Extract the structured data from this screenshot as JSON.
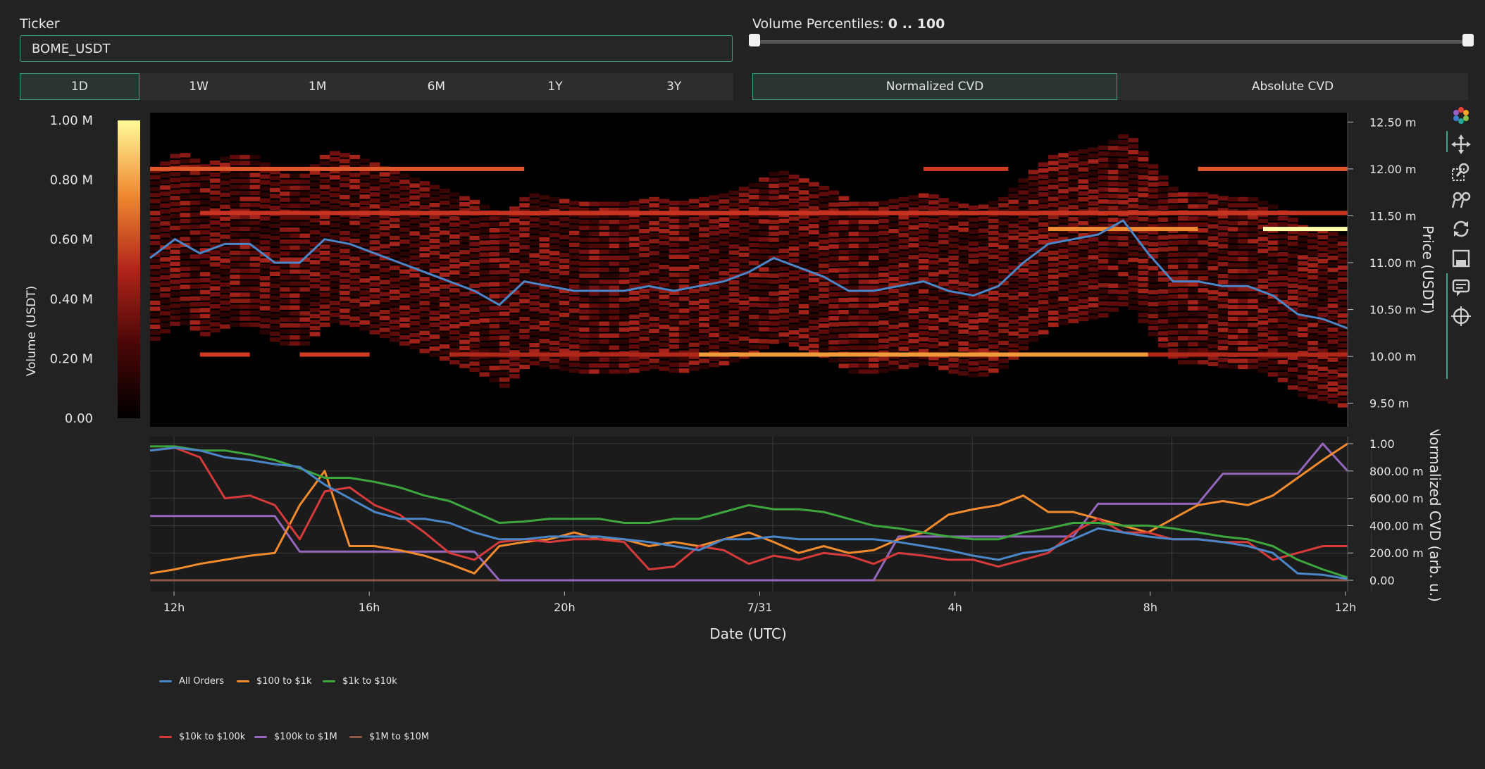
{
  "ticker": {
    "label": "Ticker",
    "value": "BOME_USDT"
  },
  "volume_percentiles": {
    "label": "Volume Percentiles:",
    "range": "0 .. 100",
    "low": 0,
    "high": 100
  },
  "timeframes": [
    "1D",
    "1W",
    "1M",
    "6M",
    "1Y",
    "3Y"
  ],
  "active_timeframe": "1D",
  "cvd_modes": [
    "Normalized CVD",
    "Absolute CVD"
  ],
  "active_cvd_mode": "Normalized CVD",
  "modebar": [
    "logo-icon",
    "pan-icon",
    "zoom-icon",
    "autoscale-icon",
    "reset-icon",
    "save-icon",
    "hover-icon",
    "spike-icon"
  ],
  "colors": {
    "accent": "#3fa08a",
    "All Orders": "#4a86c8",
    "$100 to $1k": "#f28a2e",
    "$1k to $10k": "#3ea63e",
    "$10k to $100k": "#d63a3a",
    "$100k to $1M": "#9467bd",
    "$1M to $10M": "#8c564b"
  },
  "chart_data": [
    {
      "type": "heatmap",
      "ylabel": "Price (USDT)",
      "colorbar_label": "Volume (USDT)",
      "colorbar_ticks": [
        "0.00",
        "0.20 M",
        "0.40 M",
        "0.60 M",
        "0.80 M",
        "1.00 M"
      ],
      "y_ticks": [
        "9.50 m",
        "10.00 m",
        "10.50 m",
        "11.00 m",
        "11.50 m",
        "12.00 m",
        "12.50 m"
      ],
      "ylim": [
        9.25,
        12.6
      ],
      "price_series": {
        "name": "Price",
        "x_hours": [
          0,
          0.5,
          1,
          1.5,
          2,
          2.5,
          3,
          3.5,
          4,
          4.5,
          5,
          5.5,
          6,
          6.5,
          7,
          7.5,
          8,
          8.5,
          9,
          9.5,
          10,
          10.5,
          11,
          11.5,
          12,
          12.5,
          13,
          13.5,
          14,
          14.5,
          15,
          15.5,
          16,
          16.5,
          17,
          17.5,
          18,
          18.5,
          19,
          19.5,
          20,
          20.5,
          21,
          21.5,
          22,
          22.5,
          23,
          23.5,
          24
        ],
        "values": [
          11.05,
          11.25,
          11.1,
          11.2,
          11.2,
          11.0,
          11.0,
          11.25,
          11.2,
          11.1,
          11.0,
          10.9,
          10.8,
          10.7,
          10.55,
          10.8,
          10.75,
          10.7,
          10.7,
          10.7,
          10.75,
          10.7,
          10.75,
          10.8,
          10.9,
          11.05,
          10.95,
          10.85,
          10.7,
          10.7,
          10.75,
          10.8,
          10.7,
          10.65,
          10.75,
          11.0,
          11.2,
          11.25,
          11.3,
          11.45,
          11.1,
          10.8,
          10.8,
          10.75,
          10.75,
          10.65,
          10.45,
          10.4,
          10.3
        ]
      }
    },
    {
      "type": "line",
      "xlabel": "Date (UTC)",
      "ylabel": "Normalized CVD (arb. u.)",
      "x_ticks": [
        "12h",
        "16h",
        "20h",
        "7/31",
        "4h",
        "8h",
        "12h"
      ],
      "y_ticks": [
        "0.00",
        "200.00 m",
        "400.00 m",
        "600.00 m",
        "800.00 m",
        "1.00"
      ],
      "ylim": [
        0,
        1
      ],
      "x_hours": [
        0,
        0.5,
        1,
        1.5,
        2,
        2.5,
        3,
        3.5,
        4,
        4.5,
        5,
        5.5,
        6,
        6.5,
        7,
        7.5,
        8,
        8.5,
        9,
        9.5,
        10,
        10.5,
        11,
        11.5,
        12,
        12.5,
        13,
        13.5,
        14,
        14.5,
        15,
        15.5,
        16,
        16.5,
        17,
        17.5,
        18,
        18.5,
        19,
        19.5,
        20,
        20.5,
        21,
        21.5,
        22,
        22.5,
        23,
        23.5,
        24
      ],
      "series": [
        {
          "name": "All Orders",
          "values": [
            0.95,
            0.97,
            0.95,
            0.9,
            0.88,
            0.85,
            0.83,
            0.7,
            0.6,
            0.5,
            0.45,
            0.45,
            0.42,
            0.35,
            0.3,
            0.3,
            0.32,
            0.32,
            0.32,
            0.3,
            0.28,
            0.25,
            0.22,
            0.3,
            0.3,
            0.32,
            0.3,
            0.3,
            0.3,
            0.3,
            0.28,
            0.25,
            0.22,
            0.18,
            0.15,
            0.2,
            0.22,
            0.3,
            0.38,
            0.35,
            0.32,
            0.3,
            0.3,
            0.28,
            0.25,
            0.2,
            0.05,
            0.04,
            0.01
          ]
        },
        {
          "name": "$100 to $1k",
          "values": [
            0.05,
            0.08,
            0.12,
            0.15,
            0.18,
            0.2,
            0.55,
            0.8,
            0.25,
            0.25,
            0.22,
            0.18,
            0.12,
            0.05,
            0.25,
            0.28,
            0.3,
            0.35,
            0.3,
            0.3,
            0.25,
            0.28,
            0.25,
            0.3,
            0.35,
            0.28,
            0.2,
            0.25,
            0.2,
            0.22,
            0.3,
            0.35,
            0.48,
            0.52,
            0.55,
            0.62,
            0.5,
            0.5,
            0.45,
            0.4,
            0.35,
            0.45,
            0.55,
            0.58,
            0.55,
            0.62,
            0.75,
            0.88,
            1.0
          ]
        },
        {
          "name": "$1k to $10k",
          "values": [
            0.98,
            0.98,
            0.95,
            0.95,
            0.92,
            0.88,
            0.82,
            0.75,
            0.75,
            0.72,
            0.68,
            0.62,
            0.58,
            0.5,
            0.42,
            0.43,
            0.45,
            0.45,
            0.45,
            0.42,
            0.42,
            0.45,
            0.45,
            0.5,
            0.55,
            0.52,
            0.52,
            0.5,
            0.45,
            0.4,
            0.38,
            0.35,
            0.32,
            0.3,
            0.3,
            0.35,
            0.38,
            0.42,
            0.42,
            0.4,
            0.4,
            0.38,
            0.35,
            0.32,
            0.3,
            0.25,
            0.15,
            0.08,
            0.02
          ]
        },
        {
          "name": "$10k to $100k",
          "values": [
            0.95,
            0.97,
            0.9,
            0.6,
            0.62,
            0.55,
            0.3,
            0.65,
            0.68,
            0.55,
            0.48,
            0.35,
            0.2,
            0.15,
            0.28,
            0.3,
            0.28,
            0.3,
            0.3,
            0.28,
            0.08,
            0.1,
            0.25,
            0.22,
            0.12,
            0.18,
            0.15,
            0.2,
            0.18,
            0.12,
            0.2,
            0.18,
            0.15,
            0.15,
            0.1,
            0.15,
            0.2,
            0.35,
            0.45,
            0.35,
            0.35,
            0.3,
            0.3,
            0.28,
            0.28,
            0.15,
            0.2,
            0.25,
            0.25
          ]
        },
        {
          "name": "$100k to $1M",
          "values": [
            0.47,
            0.47,
            0.47,
            0.47,
            0.47,
            0.47,
            0.21,
            0.21,
            0.21,
            0.21,
            0.21,
            0.21,
            0.21,
            0.21,
            0.0,
            0.0,
            0.0,
            0.0,
            0.0,
            0.0,
            0.0,
            0.0,
            0.0,
            0.0,
            0.0,
            0.0,
            0.0,
            0.0,
            0.0,
            0.0,
            0.32,
            0.32,
            0.32,
            0.32,
            0.32,
            0.32,
            0.32,
            0.32,
            0.56,
            0.56,
            0.56,
            0.56,
            0.56,
            0.78,
            0.78,
            0.78,
            0.78,
            1.0,
            0.8
          ]
        },
        {
          "name": "$1M to $10M",
          "values": [
            0.0,
            0.0,
            0.0,
            0.0,
            0.0,
            0.0,
            0.0,
            0.0,
            0.0,
            0.0,
            0.0,
            0.0,
            0.0,
            0.0,
            0.0,
            0.0,
            0.0,
            0.0,
            0.0,
            0.0,
            0.0,
            0.0,
            0.0,
            0.0,
            0.0,
            0.0,
            0.0,
            0.0,
            0.0,
            0.0,
            0.0,
            0.0,
            0.0,
            0.0,
            0.0,
            0.0,
            0.0,
            0.0,
            0.0,
            0.0,
            0.0,
            0.0,
            0.0,
            0.0,
            0.0,
            0.0,
            0.0,
            0.0,
            0.0
          ]
        }
      ],
      "legend_position": "bottom-left"
    }
  ]
}
